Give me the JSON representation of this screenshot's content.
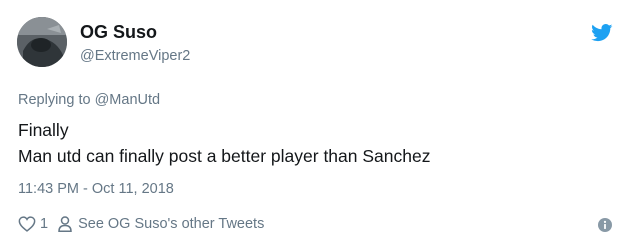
{
  "user": {
    "name": "OG Suso",
    "handle": "@ExtremeViper2"
  },
  "reply": {
    "prefix": "Replying to",
    "mention": "@ManUtd"
  },
  "tweet": {
    "lines": [
      "Finally",
      "Man utd can finally post a better player than Sanchez"
    ]
  },
  "timestamp": "11:43 PM - Oct 11, 2018",
  "actions": {
    "like_count": "1",
    "other_tweets_label": "See OG Suso's other Tweets"
  },
  "icons": {
    "brand": "twitter-bird-icon",
    "like": "heart-icon",
    "profile": "person-icon",
    "info": "info-icon"
  },
  "colors": {
    "brand_blue": "#1da1f2",
    "text_primary": "#14171a",
    "text_secondary": "#657786"
  }
}
